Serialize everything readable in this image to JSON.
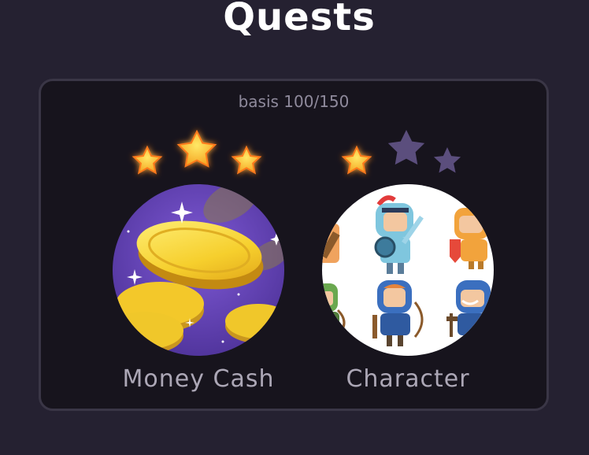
{
  "header": {
    "title": "Quests"
  },
  "panel": {
    "progress_text": "basis 100/150",
    "quests": [
      {
        "label": "Money Cash",
        "stars_earned": 3,
        "stars_total": 3,
        "image_icon": "gold-coins-icon"
      },
      {
        "label": "Character",
        "stars_earned": 1,
        "stars_total": 3,
        "image_icon": "character-knights-archers-icon"
      }
    ]
  },
  "colors": {
    "background": "#252131",
    "panel": "#17141d",
    "star_filled": "#fbc531",
    "star_empty": "#5b4e7d",
    "coin_bg": "#5a3ea6",
    "coin_gold": "#f7d02e"
  }
}
